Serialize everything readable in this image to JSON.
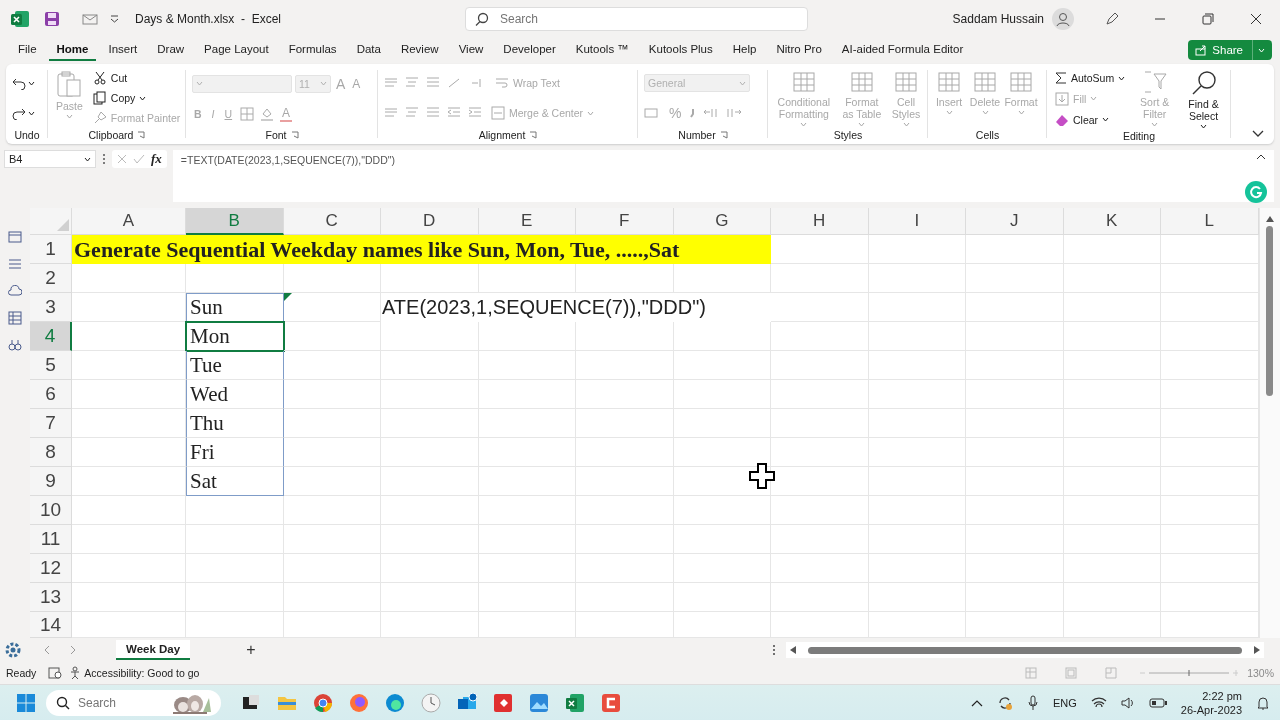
{
  "window": {
    "title": "Days & Month.xlsx  -  Excel"
  },
  "search": {
    "placeholder": "Search"
  },
  "user": {
    "name": "Saddam Hussain"
  },
  "tabs": [
    {
      "label": "File",
      "selected": false
    },
    {
      "label": "Home",
      "selected": true
    },
    {
      "label": "Insert",
      "selected": false
    },
    {
      "label": "Draw",
      "selected": false
    },
    {
      "label": "Page Layout",
      "selected": false
    },
    {
      "label": "Formulas",
      "selected": false
    },
    {
      "label": "Data",
      "selected": false
    },
    {
      "label": "Review",
      "selected": false
    },
    {
      "label": "View",
      "selected": false
    },
    {
      "label": "Developer",
      "selected": false
    },
    {
      "label": "Kutools ™",
      "selected": false
    },
    {
      "label": "Kutools Plus",
      "selected": false
    },
    {
      "label": "Help",
      "selected": false
    },
    {
      "label": "Nitro Pro",
      "selected": false
    },
    {
      "label": "AI-aided Formula Editor",
      "selected": false
    }
  ],
  "share_button": {
    "label": "Share"
  },
  "ribbon": {
    "groups": [
      {
        "kind": "undo",
        "label": "Undo"
      },
      {
        "kind": "clipboard",
        "label": "Clipboard",
        "paste": {
          "label": "Paste",
          "disabled": true
        },
        "items": [
          {
            "label": "Cut",
            "disabled": false
          },
          {
            "label": "Copy",
            "disabled": false
          },
          {
            "label": "Format Painter",
            "disabled": true
          }
        ]
      },
      {
        "kind": "font",
        "label": "Font",
        "size": "11",
        "size_buttons": [
          "A",
          "A"
        ],
        "style_buttons": [
          "B",
          "I",
          "U"
        ],
        "color_button": "A",
        "disabled": true
      },
      {
        "kind": "alignment",
        "label": "Alignment",
        "items": [
          {
            "label": "Wrap Text",
            "disabled": true
          },
          {
            "label": "Merge & Center",
            "disabled": true
          }
        ]
      },
      {
        "kind": "number",
        "label": "Number",
        "format": "General",
        "symbol": "%",
        "disabled": true
      },
      {
        "kind": "styles",
        "label": "Styles",
        "items": [
          {
            "label": "Conditional Formatting",
            "disabled": true
          },
          {
            "label": "Format as Table",
            "disabled": true
          },
          {
            "label": "Cell Styles",
            "disabled": true
          }
        ]
      },
      {
        "kind": "cells",
        "label": "Cells",
        "items": [
          {
            "label": "Insert",
            "disabled": true
          },
          {
            "label": "Delete",
            "disabled": true
          },
          {
            "label": "Format",
            "disabled": true
          }
        ]
      },
      {
        "kind": "editing",
        "label": "Editing",
        "items": [
          {
            "label": "AutoSum",
            "disabled": false
          },
          {
            "label": "Fill",
            "disabled": true
          },
          {
            "label": "Clear",
            "disabled": false
          },
          {
            "label": "Sort & Filter",
            "disabled": true
          },
          {
            "label": "Find & Select",
            "disabled": false
          }
        ]
      }
    ]
  },
  "formula_bar": {
    "name_box": "B4",
    "function_label": "fx",
    "formula": "=TEXT(DATE(2023,1,SEQUENCE(7)),\"DDD\")"
  },
  "sheet": {
    "columns": [
      {
        "label": "A",
        "selected": false
      },
      {
        "label": "B",
        "selected": true
      },
      {
        "label": "C",
        "selected": false
      },
      {
        "label": "D",
        "selected": false
      },
      {
        "label": "E",
        "selected": false
      },
      {
        "label": "F",
        "selected": false
      },
      {
        "label": "G",
        "selected": false
      },
      {
        "label": "H",
        "selected": false
      },
      {
        "label": "I",
        "selected": false
      },
      {
        "label": "J",
        "selected": false
      },
      {
        "label": "K",
        "selected": false
      },
      {
        "label": "L",
        "selected": false
      }
    ],
    "rows": [
      {
        "label": "1",
        "selected": false
      },
      {
        "label": "2",
        "selected": false
      },
      {
        "label": "3",
        "selected": false
      },
      {
        "label": "4",
        "selected": true
      },
      {
        "label": "5",
        "selected": false
      },
      {
        "label": "6",
        "selected": false
      },
      {
        "label": "7",
        "selected": false
      },
      {
        "label": "8",
        "selected": false
      },
      {
        "label": "9",
        "selected": false
      },
      {
        "label": "10",
        "selected": false
      },
      {
        "label": "11",
        "selected": false
      },
      {
        "label": "12",
        "selected": false
      },
      {
        "label": "13",
        "selected": false
      },
      {
        "label": "14",
        "selected": false
      }
    ],
    "title": "Generate Sequential Weekday names like Sun, Mon, Tue, .....,Sat",
    "day_cells": [
      {
        "text": "Sun",
        "selected": false
      },
      {
        "text": "Mon",
        "selected": true
      },
      {
        "text": "Tue",
        "selected": false
      },
      {
        "text": "Wed",
        "selected": false
      },
      {
        "text": "Thu",
        "selected": false
      },
      {
        "text": "Fri",
        "selected": false
      },
      {
        "text": "Sat",
        "selected": false
      }
    ],
    "overflow_text": "ATE(2023,1,SEQUENCE(7)),\"DDD\")"
  },
  "sheet_tabs": {
    "tabs": [
      {
        "label": "Week Day",
        "selected": true
      }
    ],
    "add": "+"
  },
  "status_bar": {
    "mode": "Ready",
    "accessibility": "Accessibility: Good to go",
    "zoom": "130%"
  },
  "taskbar": {
    "search": {
      "placeholder": "Search"
    },
    "language": "ENG",
    "time": "2:22 pm",
    "date": "26-Apr-2023"
  }
}
